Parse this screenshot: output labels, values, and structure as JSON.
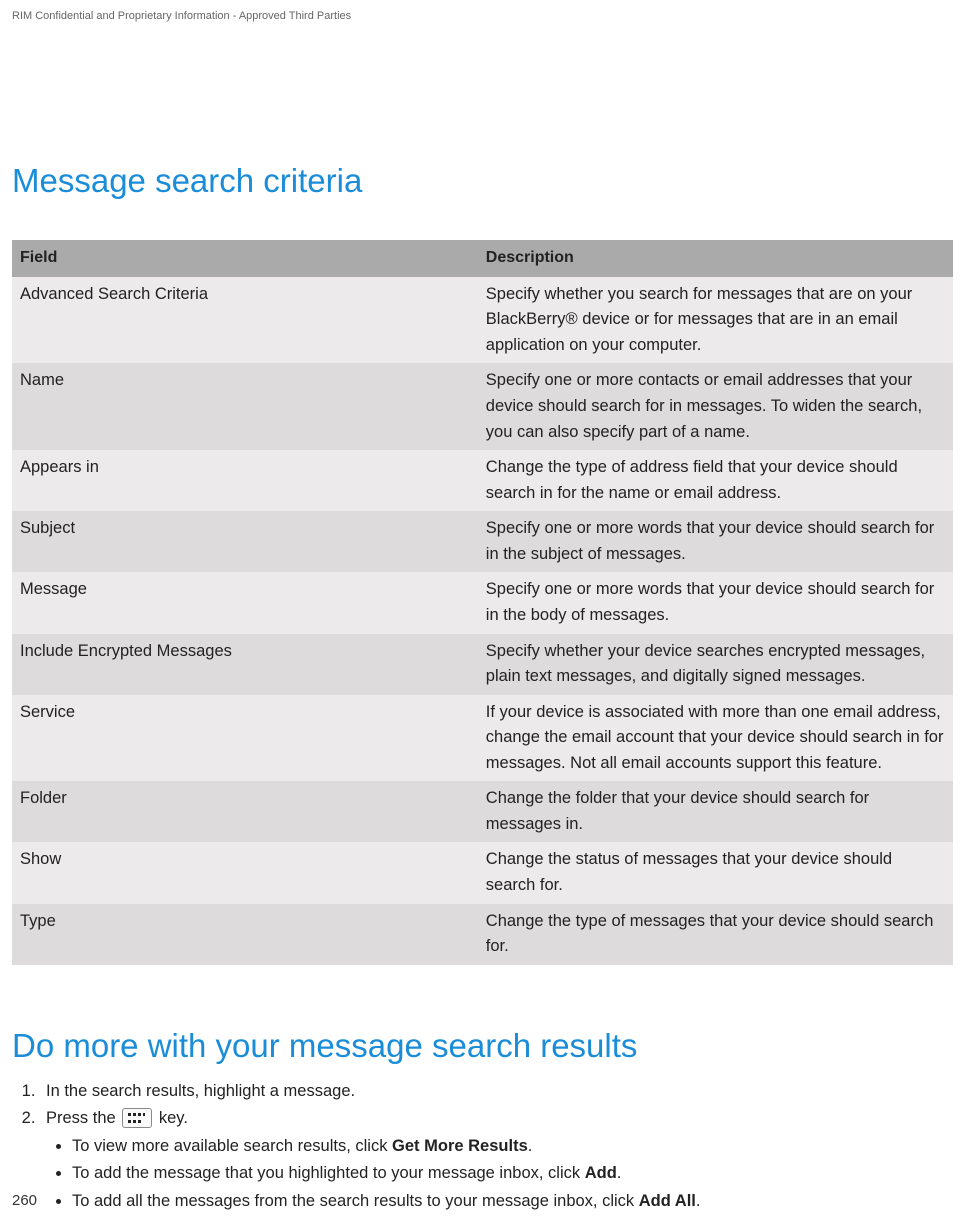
{
  "header_confidential": "RIM Confidential and Proprietary Information - Approved Third Parties",
  "title1": "Message search criteria",
  "table": {
    "headers": {
      "field": "Field",
      "description": "Description"
    },
    "rows": [
      {
        "field": "Advanced Search Criteria",
        "description": "Specify whether you search for messages that are on your BlackBerry® device or for messages that are in an email application on your computer."
      },
      {
        "field": "Name",
        "description": "Specify one or more contacts or email addresses that your device should search for in messages. To widen the search, you can also specify part of a name."
      },
      {
        "field": "Appears in",
        "description": "Change the type of address field that your device should search in for the name or email address."
      },
      {
        "field": "Subject",
        "description": "Specify one or more words that your device should search for in the subject of messages."
      },
      {
        "field": "Message",
        "description": "Specify one or more words that your device should search for in the body of messages."
      },
      {
        "field": "Include Encrypted Messages",
        "description": "Specify whether your device searches encrypted messages, plain text messages, and digitally signed messages."
      },
      {
        "field": "Service",
        "description": "If your device is associated with more than one email address, change the email account that your device should search in for messages. Not all email accounts support this feature."
      },
      {
        "field": "Folder",
        "description": "Change the folder that your device should search for messages in."
      },
      {
        "field": "Show",
        "description": "Change the status of messages that your device should search for."
      },
      {
        "field": "Type",
        "description": "Change the type of messages that your device should search for."
      }
    ]
  },
  "title2": "Do more with your message search results",
  "steps": {
    "s1": "In the search results, highlight a message.",
    "s2_pre": "Press the ",
    "s2_post": " key.",
    "bullets": {
      "b1_pre": "To view more available search results, click ",
      "b1_bold": "Get More Results",
      "b1_post": ".",
      "b2_pre": "To add the message that you highlighted to your message inbox, click ",
      "b2_bold": "Add",
      "b2_post": ".",
      "b3_pre": "To add all the messages from the search results to your message inbox, click ",
      "b3_bold": "Add All",
      "b3_post": "."
    }
  },
  "page_number": "260"
}
